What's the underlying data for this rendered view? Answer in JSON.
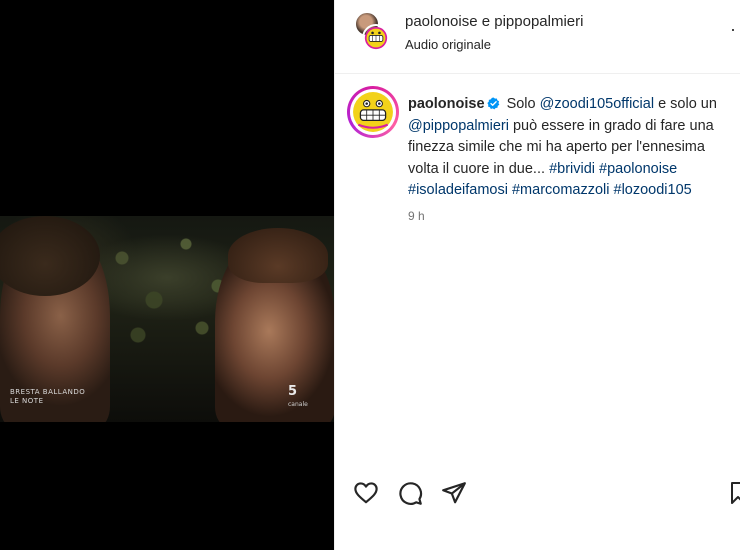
{
  "header": {
    "users": "paolonoise e pippopalmieri",
    "audio": "Audio originale",
    "more_glyph": "·"
  },
  "video": {
    "overlay_line1": "BRESTA BALLANDO",
    "overlay_line2": "LE NOTE",
    "channel": "5",
    "channel_sub": "canale"
  },
  "caption": {
    "username": "paolonoise",
    "verified": true,
    "t1": " Solo ",
    "mention1": "@zoodi105official",
    "t2": " e solo un ",
    "mention2": "@pippopalmieri",
    "t3": " può essere in grado di fare una finezza simile che mi ha aperto per l'ennesima volta il cuore in due... ",
    "tag1": "#brividi",
    "tag2": "#paolonoise",
    "tag3": "#isoladeifamosi",
    "tag4": "#marcomazzoli",
    "tag5": "#lozoodi105",
    "time": "9 h"
  },
  "actions": {
    "icons": [
      "heart-icon",
      "comment-icon",
      "share-icon",
      "bookmark-icon"
    ]
  },
  "colors": {
    "link": "#00376b",
    "text": "#262626",
    "muted": "#737373",
    "verified": "#0095f6",
    "avatar_ring": "#d81ea0",
    "logo_yellow": "#f2d21a"
  }
}
